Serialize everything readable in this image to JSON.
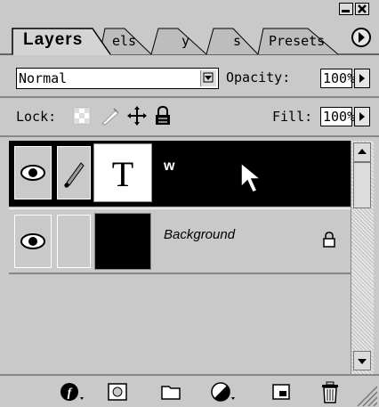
{
  "palette": {
    "tabs": [
      {
        "label": "Layers",
        "active": true
      },
      {
        "label": "els",
        "active": false
      },
      {
        "label": "y",
        "active": false
      },
      {
        "label": "s",
        "active": false
      },
      {
        "label": "Presets",
        "active": false
      }
    ],
    "menu_icon": "circle-arrow-right-icon",
    "window_buttons": [
      "minimize-icon",
      "close-icon"
    ]
  },
  "controls": {
    "blend_mode": "Normal",
    "opacity_label": "Opacity:",
    "opacity_value": "100%",
    "lock_label": "Lock:",
    "lock_icons": [
      "lock-transparent-pixels-icon",
      "lock-image-pixels-icon",
      "lock-position-icon",
      "lock-all-icon"
    ],
    "fill_label": "Fill:",
    "fill_value": "100%"
  },
  "layers": [
    {
      "thumbnail_glyph": "T",
      "name": "w",
      "type": "text",
      "selected": true,
      "visible": true,
      "linked_brush": true,
      "locked": false
    },
    {
      "thumbnail_glyph": "",
      "name": "Background",
      "type": "image",
      "selected": false,
      "visible": true,
      "linked_brush": false,
      "locked": true
    }
  ],
  "bottom_bar_icons": [
    "layer-style-icon",
    "layer-mask-icon",
    "new-group-icon",
    "adjustment-layer-icon",
    "new-layer-icon",
    "trash-icon"
  ],
  "colors": {
    "selected_row": "#000000",
    "panel_bg": "#c9c9c9"
  }
}
